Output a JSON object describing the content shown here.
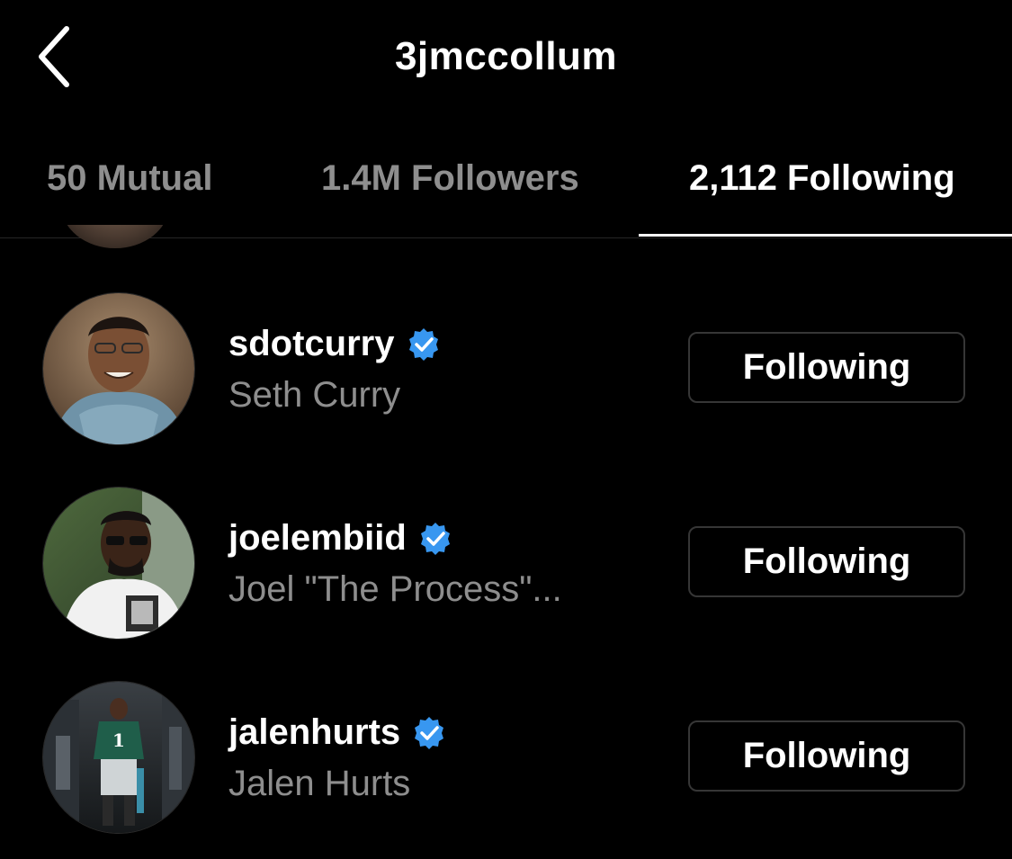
{
  "header": {
    "title": "3jmccollum",
    "back_icon": "chevron-left-icon"
  },
  "tabs": [
    {
      "label": "50 Mutual",
      "active": false
    },
    {
      "label": "1.4M Followers",
      "active": false
    },
    {
      "label": "2,112 Following",
      "active": true
    }
  ],
  "colors": {
    "background": "#000000",
    "text_primary": "#ffffff",
    "text_secondary": "#8e8e8e",
    "verified_badge": "#3897f0",
    "button_border": "#363636"
  },
  "list": [
    {
      "username": "sdotcurry",
      "full_name": "Seth Curry",
      "verified": true,
      "button_label": "Following"
    },
    {
      "username": "joelembiid",
      "full_name": "Joel \"The Process\"...",
      "verified": true,
      "button_label": "Following"
    },
    {
      "username": "jalenhurts",
      "full_name": "Jalen Hurts",
      "verified": true,
      "button_label": "Following"
    }
  ]
}
